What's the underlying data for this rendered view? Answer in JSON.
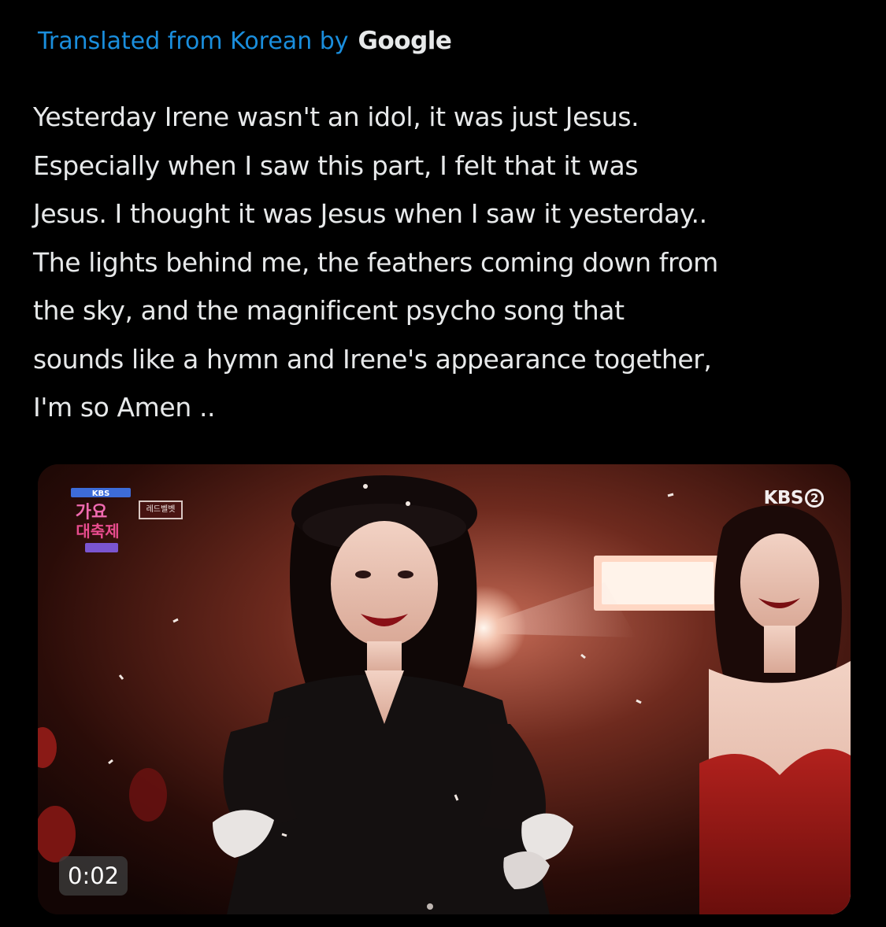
{
  "translation": {
    "label": "Translated from Korean by",
    "provider": "Google"
  },
  "tweet": {
    "lines": [
      "Yesterday Irene wasn't an idol, it was just Jesus.",
      "Especially when I saw this part, I felt that it was",
      "Jesus. I thought it was Jesus when I saw it yesterday..",
      "The lights behind me, the feathers coming down from",
      "the sky, and the magnificent psycho song that",
      "sounds like a hymn and Irene's appearance together,",
      "I'm so Amen .."
    ]
  },
  "video": {
    "duration": "0:02",
    "channel_name": "KBS",
    "channel_number": "2",
    "show_logo_lines": [
      "KBS",
      "가요",
      "대축제"
    ],
    "member_tag": "레드벨벳"
  },
  "colors": {
    "background": "#000000",
    "text": "#e7e9ea",
    "translated_link": "#1d9bf0"
  }
}
